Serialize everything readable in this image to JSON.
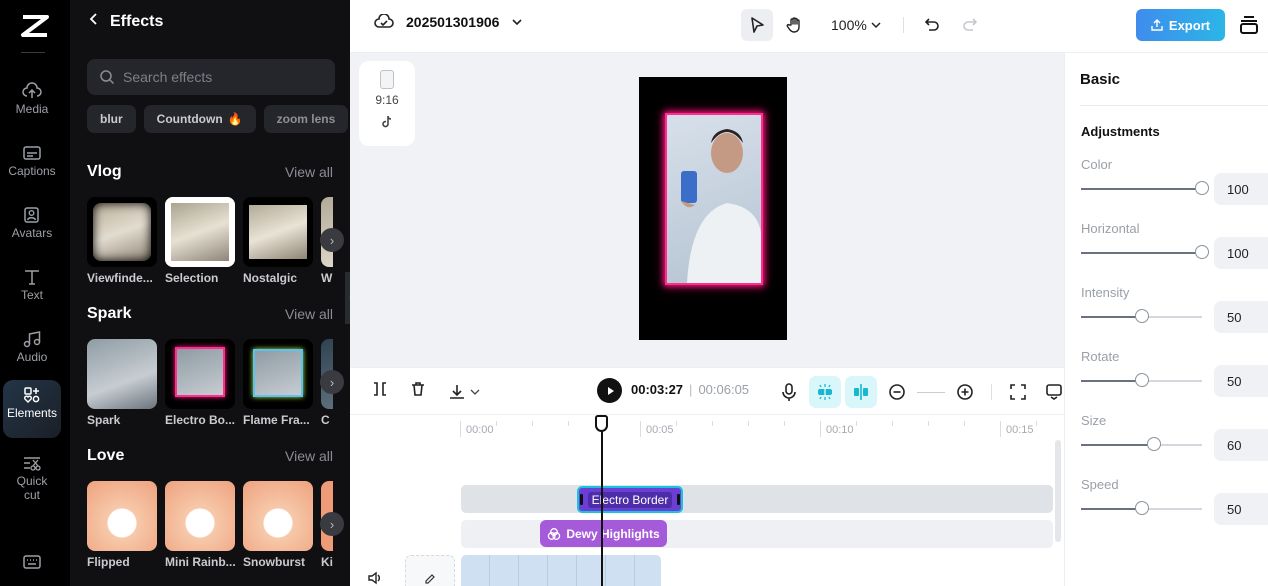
{
  "rail": {
    "items": [
      {
        "label": "Media",
        "icon": "cloud-upload-icon"
      },
      {
        "label": "Captions",
        "icon": "captions-icon"
      },
      {
        "label": "Avatars",
        "icon": "avatar-icon"
      },
      {
        "label": "Text",
        "icon": "text-icon"
      },
      {
        "label": "Audio",
        "icon": "music-note-icon"
      },
      {
        "label": "Elements",
        "icon": "elements-icon",
        "active": true
      },
      {
        "label_line1": "Quick",
        "label_line2": "cut",
        "icon": "quick-cut-icon"
      }
    ]
  },
  "effects_panel": {
    "title": "Effects",
    "search_placeholder": "Search effects",
    "chips": [
      "blur",
      "Countdown",
      "zoom lens"
    ],
    "view_all": "View all",
    "sections": [
      {
        "title": "Vlog",
        "items": [
          "Viewfinde...",
          "Selection",
          "Nostalgic",
          "W"
        ]
      },
      {
        "title": "Spark",
        "items": [
          "Spark",
          "Electro Bo...",
          "Flame Fra...",
          "C"
        ]
      },
      {
        "title": "Love",
        "items": [
          "Flipped",
          "Mini Rainb...",
          "Snowburst",
          "Ki"
        ]
      }
    ]
  },
  "topbar": {
    "project_name": "202501301906",
    "zoom": "100%",
    "export_label": "Export"
  },
  "canvas": {
    "aspect_ratio": "9:16"
  },
  "properties": {
    "tab": "Basic",
    "section": "Adjustments",
    "params": [
      {
        "label": "Color",
        "value": "100",
        "fraction": 1.0
      },
      {
        "label": "Horizontal",
        "value": "100",
        "fraction": 1.0
      },
      {
        "label": "Intensity",
        "value": "50",
        "fraction": 0.5
      },
      {
        "label": "Rotate",
        "value": "50",
        "fraction": 0.5
      },
      {
        "label": "Size",
        "value": "60",
        "fraction": 0.6
      },
      {
        "label": "Speed",
        "value": "50",
        "fraction": 0.5
      }
    ]
  },
  "timeline": {
    "current_time": "00:03:27",
    "total_time": "00:06:05",
    "ruler_labels": [
      "00:00",
      "00:05",
      "00:10",
      "00:15"
    ],
    "clips": {
      "effect": "Electro Border",
      "filter": "Dewy Highlights"
    }
  },
  "colors": {
    "accent": "#3f8cec",
    "effect_clip": "#6b3fd6",
    "filter_clip": "#a55ad9",
    "selection": "#18c3dc"
  }
}
